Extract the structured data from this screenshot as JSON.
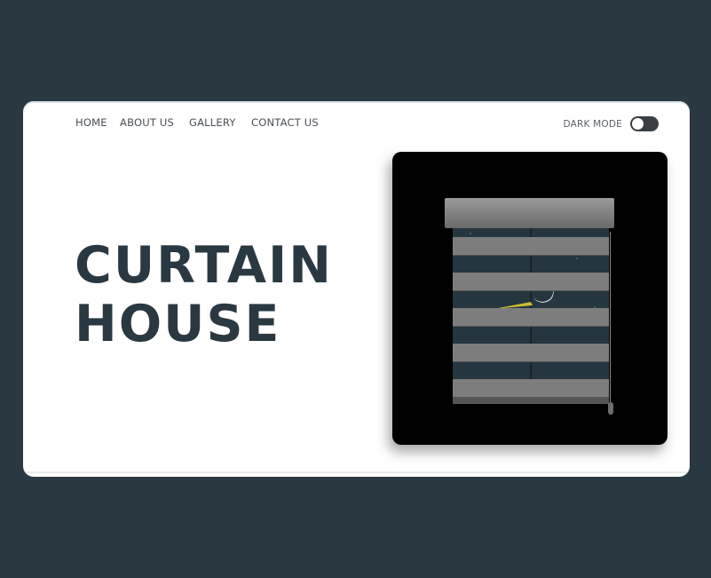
{
  "nav": {
    "items": [
      {
        "label": "HOME"
      },
      {
        "label": "ABOUT US"
      },
      {
        "label": "GALLERY"
      },
      {
        "label": "CONTACT US"
      }
    ]
  },
  "dark_mode": {
    "label": "DARK MODE",
    "enabled": false
  },
  "hero": {
    "title_line1": "CURTAIN",
    "title_line2": "HOUSE"
  },
  "illustration": {
    "subject": "zebra-roller-blind-over-night-window",
    "icons": [
      "moon-icon",
      "comet-icon"
    ]
  },
  "colors": {
    "background": "#2a3941",
    "card": "#ffffff",
    "title": "#2a3941",
    "frame": "#000000",
    "slat": "#7d7d7d",
    "night_sky": "#253640"
  }
}
